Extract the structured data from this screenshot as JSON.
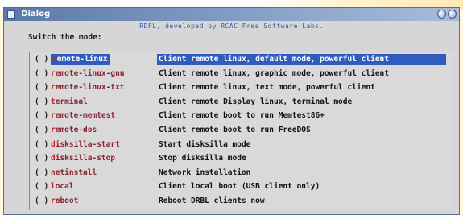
{
  "window": {
    "title": "Dialog",
    "minimize_label": "",
    "close_label": ""
  },
  "header": {
    "text": "RDFL, developed by RCAC Free Software Labs."
  },
  "prompt": {
    "text": "Switch the mode:"
  },
  "menu": {
    "items": [
      {
        "check": "( )",
        "hotkey": "r",
        "rest": "emote-linux",
        "desc": "Client remote linux, default mode, powerful client",
        "selected": true
      },
      {
        "check": "( )",
        "hotkey": "r",
        "rest": "emote-linux-gnu",
        "desc": "Client remote linux, graphic mode, powerful client",
        "selected": false
      },
      {
        "check": "( )",
        "hotkey": "r",
        "rest": "emote-linux-txt",
        "desc": "Client remote linux, text mode, powerful client",
        "selected": false
      },
      {
        "check": "( )",
        "hotkey": "t",
        "rest": "erminal",
        "desc": "Client remote Display linux, terminal mode",
        "selected": false
      },
      {
        "check": "( )",
        "hotkey": "r",
        "rest": "emote-memtest",
        "desc": "Client remote boot to run Memtest86+",
        "selected": false
      },
      {
        "check": "( )",
        "hotkey": "r",
        "rest": "emote-dos",
        "desc": "Client remote boot to run FreeDOS",
        "selected": false
      },
      {
        "check": "( )",
        "hotkey": "d",
        "rest": "isksilla-start",
        "desc": "Start disksilla mode",
        "selected": false
      },
      {
        "check": "( )",
        "hotkey": "d",
        "rest": "isksilla-stop",
        "desc": "Stop disksilla mode",
        "selected": false
      },
      {
        "check": "( )",
        "hotkey": "n",
        "rest": "etinstall",
        "desc": "Network installation",
        "selected": false
      },
      {
        "check": "( )",
        "hotkey": "l",
        "rest": "ocal",
        "desc": "Client local boot (USB client only)",
        "selected": false
      },
      {
        "check": "( )",
        "hotkey": "r",
        "rest": "eboot",
        "desc": "Reboot DRBL clients now",
        "selected": false
      }
    ]
  },
  "colors": {
    "selection": "#2f5dbf",
    "hotkey": "#c0202a",
    "header_text": "#2d5cb4",
    "titlebar": "#5b78a8"
  }
}
